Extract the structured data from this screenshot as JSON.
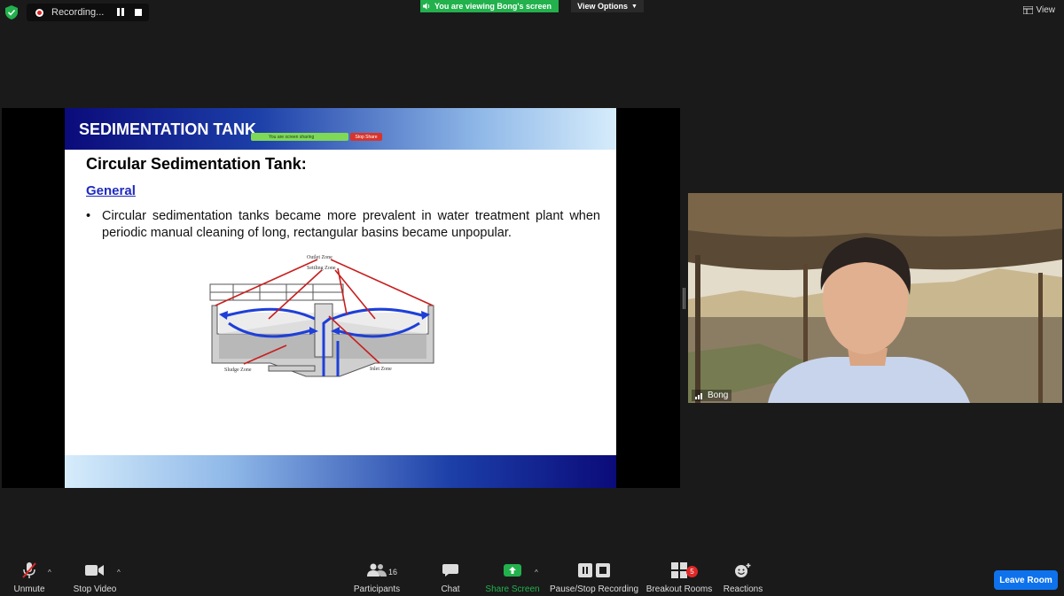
{
  "top_bar": {
    "recording_label": "Recording...",
    "viewing_banner": "You are viewing Bong's screen",
    "view_options_label": "View Options",
    "view_label": "View"
  },
  "slide": {
    "title": "SEDIMENTATION TANK",
    "screen_sharing_banner": "You are screen sharing",
    "stop_share_label": "Stop Share",
    "subtitle": "Circular Sedimentation Tank:",
    "section_link": "General",
    "bullet": "Circular sedimentation tanks became more prevalent in water treatment plant when periodic manual cleaning of long, rectangular basins became unpopular.",
    "diagram_labels": {
      "outlet": "Outlet Zone",
      "settling": "Settling Zone",
      "sludge": "Sludge Zone",
      "inlet": "Inlet Zone"
    }
  },
  "video": {
    "participant_name": "Bong"
  },
  "toolbar": {
    "unmute": "Unmute",
    "stop_video": "Stop Video",
    "participants": "Participants",
    "participants_count": "16",
    "chat": "Chat",
    "share_screen": "Share Screen",
    "pause_stop_recording": "Pause/Stop Recording",
    "breakout_rooms": "Breakout Rooms",
    "breakout_count": "5",
    "reactions": "Reactions",
    "leave_room": "Leave Room"
  },
  "colors": {
    "share_green": "#22b14c",
    "leave_blue": "#0e72ed",
    "header_navy": "#0b0b7a",
    "link_blue": "#1f2bbf",
    "arrow_red": "#c81e1e",
    "flow_blue": "#1e3fd8"
  }
}
